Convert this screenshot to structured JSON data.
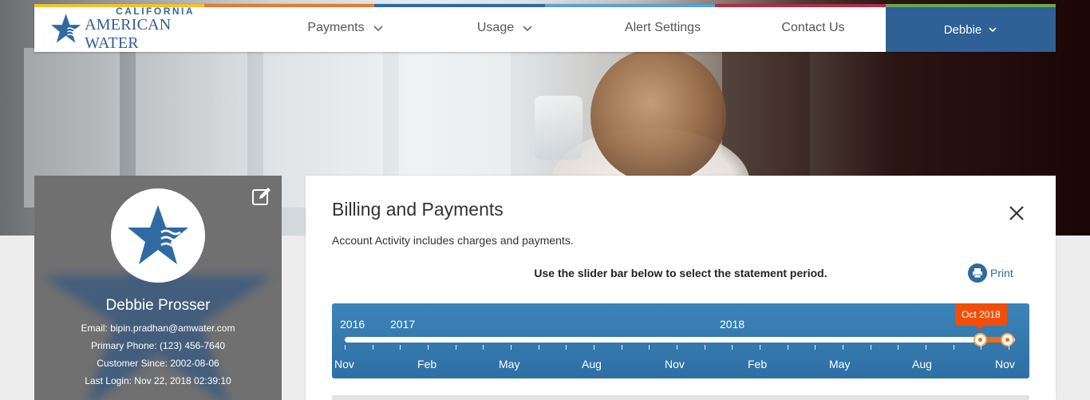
{
  "brand": {
    "top_line": "CALIFORNIA",
    "bottom_line": "AMERICAN WATER",
    "stripe_colors": [
      "#f2c22b",
      "#e57b2d",
      "#2f6aa3",
      "#5aa0d8",
      "#b52a4a",
      "#6aa84f"
    ]
  },
  "nav": {
    "items": [
      {
        "label": "Payments",
        "has_dropdown": true
      },
      {
        "label": "Usage",
        "has_dropdown": true
      },
      {
        "label": "Alert Settings",
        "has_dropdown": false
      },
      {
        "label": "Contact Us",
        "has_dropdown": false
      }
    ],
    "user_label": "Debbie"
  },
  "profile": {
    "name": "Debbie Prosser",
    "email": "Email: bipin.pradhan@amwater.com",
    "phone": "Primary Phone: (123) 456-7640",
    "customer_since": "Customer Since: 2002-08-06",
    "last_login": "Last Login: Nov 22, 2018 02:39:10"
  },
  "billing": {
    "title": "Billing and Payments",
    "subtitle": "Account Activity includes charges and payments.",
    "instruction": "Use the slider bar below to select the statement period.",
    "print_label": "Print"
  },
  "slider": {
    "years": [
      "2016",
      "2017",
      "2018"
    ],
    "months": [
      "Nov",
      "Feb",
      "May",
      "Aug",
      "Nov",
      "Feb",
      "May",
      "Aug",
      "Nov"
    ],
    "tooltip": "Oct 2018",
    "selected_start": "Oct 2018",
    "selected_end": "Nov 2018",
    "accent_color": "#f26c0d"
  },
  "colors": {
    "brand_blue": "#2f6096",
    "slider_blue": "#2e6fa4",
    "accent_orange": "#f04e0a"
  }
}
